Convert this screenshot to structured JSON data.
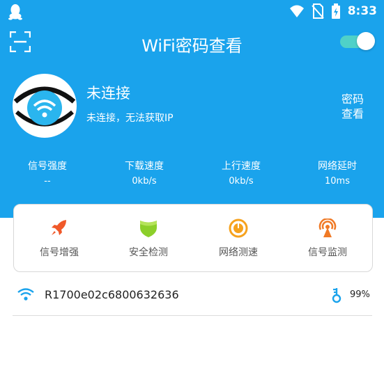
{
  "status_bar": {
    "time": "8:33",
    "icons": [
      "qq-icon",
      "wifi-icon",
      "no-sim-icon",
      "battery-charging-icon"
    ]
  },
  "header": {
    "title": "WiFi密码查看",
    "toggle_on": true
  },
  "connection": {
    "title": "未连接",
    "subtitle": "未连接，无法获取IP",
    "password_button": [
      "密码",
      "查看"
    ]
  },
  "stats": [
    {
      "label": "信号强度",
      "value": "--"
    },
    {
      "label": "下载速度",
      "value": "0kb/s"
    },
    {
      "label": "上行速度",
      "value": "0kb/s"
    },
    {
      "label": "网络延时",
      "value": "10ms"
    }
  ],
  "tools": [
    {
      "label": "信号增强",
      "icon": "rocket-icon"
    },
    {
      "label": "安全检测",
      "icon": "shield-icon"
    },
    {
      "label": "网络测速",
      "icon": "speedometer-icon"
    },
    {
      "label": "信号监测",
      "icon": "signal-tower-icon"
    }
  ],
  "networks": [
    {
      "ssid": "R1700e02c6800632636",
      "signal": "99%"
    }
  ],
  "colors": {
    "primary": "#1aa3ec",
    "toggle": "#4fd1c8",
    "rocket": "#f0592a",
    "shield": "#8ccf2a",
    "speedometer": "#f6a21e",
    "tower": "#f07a26",
    "wifi_row": "#1aa3ec"
  }
}
